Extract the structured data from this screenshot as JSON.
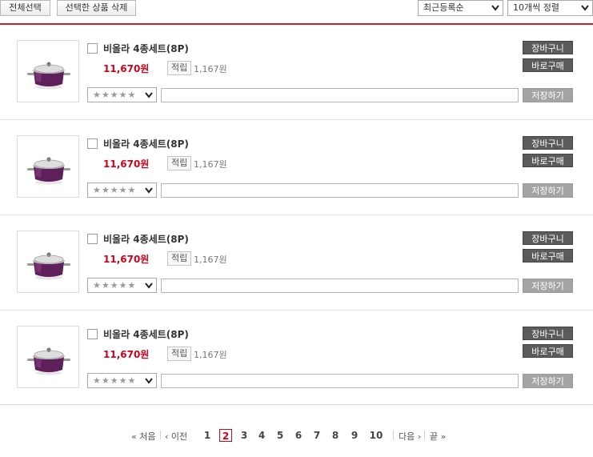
{
  "toolbar": {
    "select_all_label": "전체선택",
    "delete_selected_label": "선택한 상품 삭제",
    "sort_value": "최근등록순",
    "page_size_value": "10개씩 정렬"
  },
  "items": [
    {
      "name": "비올라 4종세트(8P)",
      "price": "11,670원",
      "points_badge": "적립",
      "points": "1,167원",
      "stars": "★★★★★",
      "cart_label": "장바구니",
      "buy_label": "바로구매",
      "save_label": "저장하기"
    },
    {
      "name": "비올라 4종세트(8P)",
      "price": "11,670원",
      "points_badge": "적립",
      "points": "1,167원",
      "stars": "★★★★★",
      "cart_label": "장바구니",
      "buy_label": "바로구매",
      "save_label": "저장하기"
    },
    {
      "name": "비올라 4종세트(8P)",
      "price": "11,670원",
      "points_badge": "적립",
      "points": "1,167원",
      "stars": "★★★★★",
      "cart_label": "장바구니",
      "buy_label": "바로구매",
      "save_label": "저장하기"
    },
    {
      "name": "비올라 4종세트(8P)",
      "price": "11,670원",
      "points_badge": "적립",
      "points": "1,167원",
      "stars": "★★★★★",
      "cart_label": "장바구니",
      "buy_label": "바로구매",
      "save_label": "저장하기"
    }
  ],
  "pagination": {
    "first_label": "« 처음",
    "prev_label": "‹ 이전",
    "pages": [
      "1",
      "2",
      "3",
      "4",
      "5",
      "6",
      "7",
      "8",
      "9",
      "10"
    ],
    "current_page": "2",
    "next_label": "다음 ›",
    "last_label": "끝 »"
  },
  "colors": {
    "accent_red": "#cc1f2c",
    "price_red": "#d0021b",
    "dark_button": "#5b5b5b",
    "save_button": "#a4a4a4",
    "product_purple": "#5e1f5b"
  },
  "icons": {
    "dropdown": "chevron-down-icon",
    "product": "purple-pot-icon"
  }
}
